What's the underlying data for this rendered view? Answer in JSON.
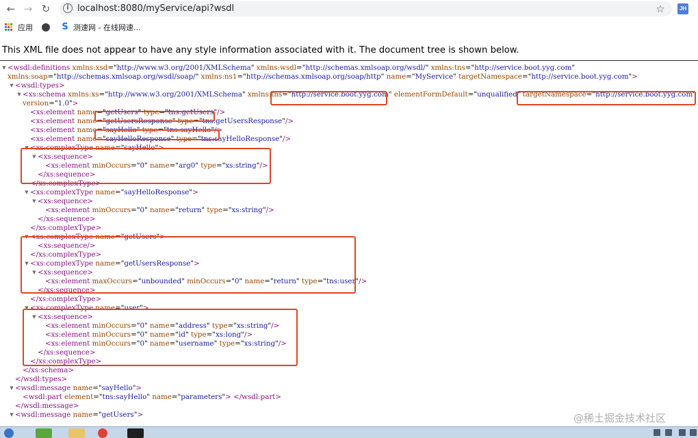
{
  "browser": {
    "url": "localhost:8080/myService/api?wsdl",
    "profile_initials": "JH",
    "icons": {
      "back": "arrow-left-icon",
      "forward": "arrow-right-icon",
      "reload": "reload-icon",
      "info": "info-icon",
      "star": "star-icon"
    },
    "bookmarks": {
      "apps_label": "应用",
      "speedtest_label": "测速网 - 在线网速..."
    }
  },
  "page": {
    "notice": "This XML file does not appear to have any style information associated with it. The document tree is shown below."
  },
  "xml_lines": [
    {
      "i": 0,
      "tw": 1,
      "s": [
        [
          "t",
          "<"
        ],
        [
          "t",
          "wsdl:definitions"
        ],
        [
          "a",
          " xmlns:xsd"
        ],
        [
          "x",
          "=\""
        ],
        [
          "v",
          "http://www.w3.org/2001/XMLSchema"
        ],
        [
          "x",
          "\""
        ],
        [
          "a",
          " xmlns:wsdl"
        ],
        [
          "x",
          "=\""
        ],
        [
          "v",
          "http://schemas.xmlsoap.org/wsdl/"
        ],
        [
          "x",
          "\""
        ],
        [
          "a",
          " xmlns:tns"
        ],
        [
          "x",
          "=\""
        ],
        [
          "v",
          "http://service.boot.yyg.com"
        ],
        [
          "x",
          "\""
        ]
      ]
    },
    {
      "i": 0,
      "tw": 0,
      "s": [
        [
          "a",
          "xmlns:soap"
        ],
        [
          "x",
          "=\""
        ],
        [
          "v",
          "http://schemas.xmlsoap.org/wsdl/soap/"
        ],
        [
          "x",
          "\""
        ],
        [
          "a",
          " xmlns:ns1"
        ],
        [
          "x",
          "=\""
        ],
        [
          "v",
          "http://schemas.xmlsoap.org/soap/http"
        ],
        [
          "x",
          "\""
        ],
        [
          "a",
          " name"
        ],
        [
          "x",
          "=\""
        ],
        [
          "v",
          "MyService"
        ],
        [
          "x",
          "\""
        ],
        [
          "a",
          " targetNamespace"
        ],
        [
          "x",
          "=\""
        ],
        [
          "v",
          "http://service.boot.yyg.com"
        ],
        [
          "x",
          "\""
        ],
        [
          "t",
          ">"
        ]
      ]
    },
    {
      "i": 1,
      "tw": 1,
      "s": [
        [
          "t",
          "<wsdl:types>"
        ]
      ]
    },
    {
      "i": 2,
      "tw": 1,
      "s": [
        [
          "t",
          "<xs:schema"
        ],
        [
          "a",
          " xmlns:xs"
        ],
        [
          "x",
          "=\""
        ],
        [
          "v",
          "http://www.w3.org/2001/XMLSchema"
        ],
        [
          "x",
          "\""
        ],
        [
          "a",
          " xmlns:tns"
        ],
        [
          "x",
          "=\""
        ],
        [
          "v",
          "http://service.boot.yyg.com"
        ],
        [
          "x",
          "\""
        ],
        [
          "a",
          " elementFormDefault"
        ],
        [
          "x",
          "=\""
        ],
        [
          "v",
          "unqualified"
        ],
        [
          "x",
          "\""
        ],
        [
          "a",
          " targetNamespace"
        ],
        [
          "x",
          "=\""
        ],
        [
          "v",
          "http://service.boot.yyg.com"
        ],
        [
          "x",
          "\""
        ]
      ]
    },
    {
      "i": 2,
      "tw": 0,
      "s": [
        [
          "a",
          "version"
        ],
        [
          "x",
          "=\""
        ],
        [
          "v",
          "1.0"
        ],
        [
          "x",
          "\""
        ],
        [
          "t",
          ">"
        ]
      ]
    },
    {
      "i": 3,
      "tw": 0,
      "s": [
        [
          "t",
          "<xs:element"
        ],
        [
          "a",
          " name"
        ],
        [
          "x",
          "=\""
        ],
        [
          "v",
          "getUsers"
        ],
        [
          "x",
          "\""
        ],
        [
          "a",
          " type"
        ],
        [
          "x",
          "=\""
        ],
        [
          "v",
          "tns:getUsers"
        ],
        [
          "x",
          "\""
        ],
        [
          "t",
          "/>"
        ]
      ]
    },
    {
      "i": 3,
      "tw": 0,
      "s": [
        [
          "t",
          "<xs:element"
        ],
        [
          "a",
          " name"
        ],
        [
          "x",
          "=\""
        ],
        [
          "v",
          "getUsersResponse"
        ],
        [
          "x",
          "\""
        ],
        [
          "a",
          " type"
        ],
        [
          "x",
          "=\""
        ],
        [
          "v",
          "tns:getUsersResponse"
        ],
        [
          "x",
          "\""
        ],
        [
          "t",
          "/>"
        ]
      ]
    },
    {
      "i": 3,
      "tw": 0,
      "s": [
        [
          "t",
          "<xs:element"
        ],
        [
          "a",
          " name"
        ],
        [
          "x",
          "=\""
        ],
        [
          "v",
          "sayHello"
        ],
        [
          "x",
          "\""
        ],
        [
          "a",
          " type"
        ],
        [
          "x",
          "=\""
        ],
        [
          "v",
          "tns:sayHello"
        ],
        [
          "x",
          "\""
        ],
        [
          "t",
          "/>"
        ]
      ]
    },
    {
      "i": 3,
      "tw": 0,
      "s": [
        [
          "t",
          "<xs:element"
        ],
        [
          "a",
          " name"
        ],
        [
          "x",
          "=\""
        ],
        [
          "v",
          "sayHelloResponse"
        ],
        [
          "x",
          "\""
        ],
        [
          "a",
          " type"
        ],
        [
          "x",
          "=\""
        ],
        [
          "v",
          "tns:sayHelloResponse"
        ],
        [
          "x",
          "\""
        ],
        [
          "t",
          "/>"
        ]
      ]
    },
    {
      "i": 3,
      "tw": 1,
      "s": [
        [
          "t",
          "<xs:complexType"
        ],
        [
          "a",
          " name"
        ],
        [
          "x",
          "=\""
        ],
        [
          "v",
          "sayHello"
        ],
        [
          "x",
          "\""
        ],
        [
          "t",
          ">"
        ]
      ]
    },
    {
      "i": 4,
      "tw": 1,
      "s": [
        [
          "t",
          "<xs:sequence>"
        ]
      ]
    },
    {
      "i": 5,
      "tw": 0,
      "s": [
        [
          "t",
          "<xs:element"
        ],
        [
          "a",
          " minOccurs"
        ],
        [
          "x",
          "=\""
        ],
        [
          "v",
          "0"
        ],
        [
          "x",
          "\""
        ],
        [
          "a",
          " name"
        ],
        [
          "x",
          "=\""
        ],
        [
          "v",
          "arg0"
        ],
        [
          "x",
          "\""
        ],
        [
          "a",
          " type"
        ],
        [
          "x",
          "=\""
        ],
        [
          "v",
          "xs:string"
        ],
        [
          "x",
          "\""
        ],
        [
          "t",
          "/>"
        ]
      ]
    },
    {
      "i": 4,
      "tw": 0,
      "s": [
        [
          "t",
          "</xs:sequence>"
        ]
      ]
    },
    {
      "i": 3,
      "tw": 0,
      "s": [
        [
          "t",
          "</xs:complexType>"
        ]
      ]
    },
    {
      "i": 3,
      "tw": 1,
      "s": [
        [
          "t",
          "<xs:complexType"
        ],
        [
          "a",
          " name"
        ],
        [
          "x",
          "=\""
        ],
        [
          "v",
          "sayHelloResponse"
        ],
        [
          "x",
          "\""
        ],
        [
          "t",
          ">"
        ]
      ]
    },
    {
      "i": 4,
      "tw": 1,
      "s": [
        [
          "t",
          "<xs:sequence>"
        ]
      ]
    },
    {
      "i": 5,
      "tw": 0,
      "s": [
        [
          "t",
          "<xs:element"
        ],
        [
          "a",
          " minOccurs"
        ],
        [
          "x",
          "=\""
        ],
        [
          "v",
          "0"
        ],
        [
          "x",
          "\""
        ],
        [
          "a",
          " name"
        ],
        [
          "x",
          "=\""
        ],
        [
          "v",
          "return"
        ],
        [
          "x",
          "\""
        ],
        [
          "a",
          " type"
        ],
        [
          "x",
          "=\""
        ],
        [
          "v",
          "xs:string"
        ],
        [
          "x",
          "\""
        ],
        [
          "t",
          "/>"
        ]
      ]
    },
    {
      "i": 4,
      "tw": 0,
      "s": [
        [
          "t",
          "</xs:sequence>"
        ]
      ]
    },
    {
      "i": 3,
      "tw": 0,
      "s": [
        [
          "t",
          "</xs:complexType>"
        ]
      ]
    },
    {
      "i": 3,
      "tw": 1,
      "s": [
        [
          "t",
          "<xs:complexType"
        ],
        [
          "a",
          " name"
        ],
        [
          "x",
          "=\""
        ],
        [
          "v",
          "getUsers"
        ],
        [
          "x",
          "\""
        ],
        [
          "t",
          ">"
        ]
      ]
    },
    {
      "i": 4,
      "tw": 0,
      "s": [
        [
          "t",
          "<xs:sequence/>"
        ]
      ]
    },
    {
      "i": 3,
      "tw": 0,
      "s": [
        [
          "t",
          "</xs:complexType>"
        ]
      ]
    },
    {
      "i": 3,
      "tw": 1,
      "s": [
        [
          "t",
          "<xs:complexType"
        ],
        [
          "a",
          " name"
        ],
        [
          "x",
          "=\""
        ],
        [
          "v",
          "getUsersResponse"
        ],
        [
          "x",
          "\""
        ],
        [
          "t",
          ">"
        ]
      ]
    },
    {
      "i": 4,
      "tw": 1,
      "s": [
        [
          "t",
          "<xs:sequence>"
        ]
      ]
    },
    {
      "i": 5,
      "tw": 0,
      "s": [
        [
          "t",
          "<xs:element"
        ],
        [
          "a",
          " maxOccurs"
        ],
        [
          "x",
          "=\""
        ],
        [
          "v",
          "unbounded"
        ],
        [
          "x",
          "\""
        ],
        [
          "a",
          " minOccurs"
        ],
        [
          "x",
          "=\""
        ],
        [
          "v",
          "0"
        ],
        [
          "x",
          "\""
        ],
        [
          "a",
          " name"
        ],
        [
          "x",
          "=\""
        ],
        [
          "v",
          "return"
        ],
        [
          "x",
          "\""
        ],
        [
          "a",
          " type"
        ],
        [
          "x",
          "=\""
        ],
        [
          "v",
          "tns:user"
        ],
        [
          "x",
          "\""
        ],
        [
          "t",
          "/>"
        ]
      ]
    },
    {
      "i": 4,
      "tw": 0,
      "s": [
        [
          "t",
          "</xs:sequence>"
        ]
      ]
    },
    {
      "i": 3,
      "tw": 0,
      "s": [
        [
          "t",
          "</xs:complexType>"
        ]
      ]
    },
    {
      "i": 3,
      "tw": 1,
      "s": [
        [
          "t",
          "<xs:complexType"
        ],
        [
          "a",
          " name"
        ],
        [
          "x",
          "=\""
        ],
        [
          "v",
          "user"
        ],
        [
          "x",
          "\""
        ],
        [
          "t",
          ">"
        ]
      ]
    },
    {
      "i": 4,
      "tw": 1,
      "s": [
        [
          "t",
          "<xs:sequence>"
        ]
      ]
    },
    {
      "i": 5,
      "tw": 0,
      "s": [
        [
          "t",
          "<xs:element"
        ],
        [
          "a",
          " minOccurs"
        ],
        [
          "x",
          "=\""
        ],
        [
          "v",
          "0"
        ],
        [
          "x",
          "\""
        ],
        [
          "a",
          " name"
        ],
        [
          "x",
          "=\""
        ],
        [
          "v",
          "address"
        ],
        [
          "x",
          "\""
        ],
        [
          "a",
          " type"
        ],
        [
          "x",
          "=\""
        ],
        [
          "v",
          "xs:string"
        ],
        [
          "x",
          "\""
        ],
        [
          "t",
          "/>"
        ]
      ]
    },
    {
      "i": 5,
      "tw": 0,
      "s": [
        [
          "t",
          "<xs:element"
        ],
        [
          "a",
          " minOccurs"
        ],
        [
          "x",
          "=\""
        ],
        [
          "v",
          "0"
        ],
        [
          "x",
          "\""
        ],
        [
          "a",
          " name"
        ],
        [
          "x",
          "=\""
        ],
        [
          "v",
          "id"
        ],
        [
          "x",
          "\""
        ],
        [
          "a",
          " type"
        ],
        [
          "x",
          "=\""
        ],
        [
          "v",
          "xs:long"
        ],
        [
          "x",
          "\""
        ],
        [
          "t",
          "/>"
        ]
      ]
    },
    {
      "i": 5,
      "tw": 0,
      "s": [
        [
          "t",
          "<xs:element"
        ],
        [
          "a",
          " minOccurs"
        ],
        [
          "x",
          "=\""
        ],
        [
          "v",
          "0"
        ],
        [
          "x",
          "\""
        ],
        [
          "a",
          " name"
        ],
        [
          "x",
          "=\""
        ],
        [
          "v",
          "username"
        ],
        [
          "x",
          "\""
        ],
        [
          "a",
          " type"
        ],
        [
          "x",
          "=\""
        ],
        [
          "v",
          "xs:string"
        ],
        [
          "x",
          "\""
        ],
        [
          "t",
          "/>"
        ]
      ]
    },
    {
      "i": 4,
      "tw": 0,
      "s": [
        [
          "t",
          "</xs:sequence>"
        ]
      ]
    },
    {
      "i": 3,
      "tw": 0,
      "s": [
        [
          "t",
          "</xs:complexType>"
        ]
      ]
    },
    {
      "i": 2,
      "tw": 0,
      "s": [
        [
          "t",
          "</xs:schema>"
        ]
      ]
    },
    {
      "i": 1,
      "tw": 0,
      "s": [
        [
          "t",
          "</wsdl:types>"
        ]
      ]
    },
    {
      "i": 1,
      "tw": 1,
      "s": [
        [
          "t",
          "<wsdl:message"
        ],
        [
          "a",
          " name"
        ],
        [
          "x",
          "=\""
        ],
        [
          "v",
          "sayHello"
        ],
        [
          "x",
          "\""
        ],
        [
          "t",
          ">"
        ]
      ]
    },
    {
      "i": 2,
      "tw": 0,
      "s": [
        [
          "t",
          "<wsdl:part"
        ],
        [
          "a",
          " element"
        ],
        [
          "x",
          "=\""
        ],
        [
          "v",
          "tns:sayHello"
        ],
        [
          "x",
          "\""
        ],
        [
          "a",
          " name"
        ],
        [
          "x",
          "=\""
        ],
        [
          "v",
          "parameters"
        ],
        [
          "x",
          "\""
        ],
        [
          "t",
          ">"
        ],
        [
          "x",
          " "
        ],
        [
          "t",
          "</wsdl:part>"
        ]
      ]
    },
    {
      "i": 1,
      "tw": 0,
      "s": [
        [
          "t",
          "</wsdl:message>"
        ]
      ]
    },
    {
      "i": 1,
      "tw": 1,
      "s": [
        [
          "t",
          "<wsdl:message"
        ],
        [
          "a",
          " name"
        ],
        [
          "x",
          "=\""
        ],
        [
          "v",
          "getUsers"
        ],
        [
          "x",
          "\""
        ],
        [
          "t",
          ">"
        ]
      ]
    }
  ],
  "watermark": "@稀土掘金技术社区",
  "colors": {
    "highlight": "#e0441d",
    "tag": "#881280",
    "attr": "#994500",
    "value": "#1a1aa6",
    "taskbar": "#c7d7ea"
  }
}
